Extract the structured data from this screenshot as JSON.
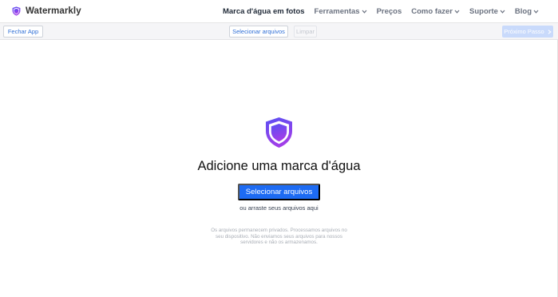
{
  "app": {
    "brand_name": "Watermarkly"
  },
  "nav": {
    "items": [
      {
        "label": "Marca d'água em fotos",
        "active": true,
        "has_dropdown": false
      },
      {
        "label": "Ferramentas",
        "active": false,
        "has_dropdown": true
      },
      {
        "label": "Preços",
        "active": false,
        "has_dropdown": false
      },
      {
        "label": "Como fazer",
        "active": false,
        "has_dropdown": true
      },
      {
        "label": "Suporte",
        "active": false,
        "has_dropdown": true
      },
      {
        "label": "Blog",
        "active": false,
        "has_dropdown": true
      }
    ]
  },
  "toolbar": {
    "close_label": "Fechar App",
    "select_label": "Selecionar arquivos",
    "clear_label": "Limpar",
    "next_label": "Próximo Passo"
  },
  "main": {
    "title": "Adicione uma marca d'água",
    "cta_label": "Selecionar arquivos",
    "drop_hint": "ou arraste seus arquivos aqui",
    "privacy_text": "Os arquivos permanecem privados. Processamos arquivos no seu dispositivo. Não enviamos seus arquivos para nossos servidores e não os armazenamos."
  },
  "icons": {
    "brand": "shield-logo-icon",
    "hero": "shield-logo-icon",
    "dropdown": "chevron-down-icon",
    "next": "chevron-right-icon"
  },
  "colors": {
    "accent": "#1d6bf3",
    "shield_gradient": [
      "#5a4ff3",
      "#a23ee8"
    ],
    "next_disabled": "#c9dafb"
  }
}
